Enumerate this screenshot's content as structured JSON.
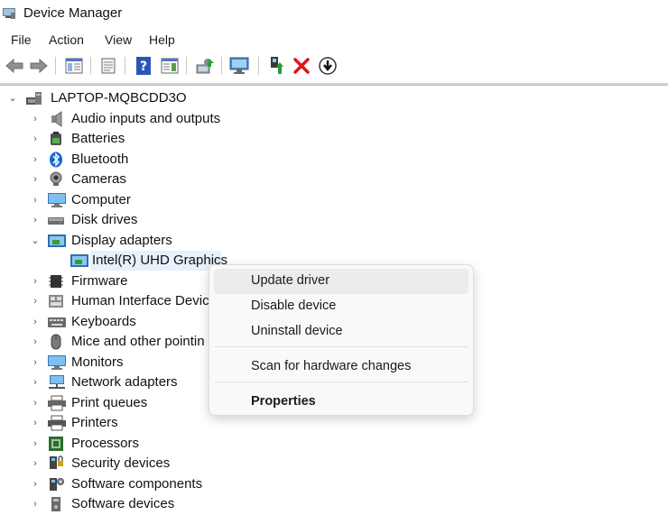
{
  "window": {
    "title": "Device Manager",
    "icon": "device-manager-icon"
  },
  "menu": {
    "file": "File",
    "action": "Action",
    "view": "View",
    "help": "Help"
  },
  "toolbar": {
    "buttons": [
      "back-arrow-icon",
      "forward-arrow-icon",
      "show-hide-console-tree-icon",
      "properties-sheet-icon",
      "help-icon",
      "action-pane-icon",
      "update-driver-software-icon",
      "scan-hardware-changes-icon",
      "enable-device-icon",
      "uninstall-device-icon",
      "disable-device-icon"
    ]
  },
  "tree": {
    "root": "LAPTOP-MQBCDD3O",
    "categories": [
      {
        "label": "Audio inputs and outputs",
        "icon": "speaker-icon"
      },
      {
        "label": "Batteries",
        "icon": "battery-icon"
      },
      {
        "label": "Bluetooth",
        "icon": "bluetooth-icon"
      },
      {
        "label": "Cameras",
        "icon": "camera-icon"
      },
      {
        "label": "Computer",
        "icon": "computer-icon"
      },
      {
        "label": "Disk drives",
        "icon": "disk-drive-icon"
      },
      {
        "label": "Display adapters",
        "icon": "display-adapter-icon",
        "expanded": true
      },
      {
        "label": "Firmware",
        "icon": "firmware-icon"
      },
      {
        "label": "Human Interface Device",
        "icon": "hid-icon"
      },
      {
        "label": "Keyboards",
        "icon": "keyboard-icon"
      },
      {
        "label": "Mice and other pointin",
        "icon": "mouse-icon"
      },
      {
        "label": "Monitors",
        "icon": "monitor-icon"
      },
      {
        "label": "Network adapters",
        "icon": "network-adapter-icon"
      },
      {
        "label": "Print queues",
        "icon": "print-queue-icon"
      },
      {
        "label": "Printers",
        "icon": "printer-icon"
      },
      {
        "label": "Processors",
        "icon": "processor-icon"
      },
      {
        "label": "Security devices",
        "icon": "security-device-icon"
      },
      {
        "label": "Software components",
        "icon": "software-component-icon"
      },
      {
        "label": "Software devices",
        "icon": "software-device-icon"
      }
    ],
    "display_child": "Intel(R) UHD Graphics"
  },
  "context_menu": {
    "update": "Update driver",
    "disable": "Disable device",
    "uninstall": "Uninstall device",
    "scan": "Scan for hardware changes",
    "properties": "Properties"
  },
  "colors": {
    "selection": "#e8f0fb",
    "menu_bg": "#f9f9f9",
    "uninstall_red": "#e0141e",
    "help_blue": "#2a56b8"
  }
}
